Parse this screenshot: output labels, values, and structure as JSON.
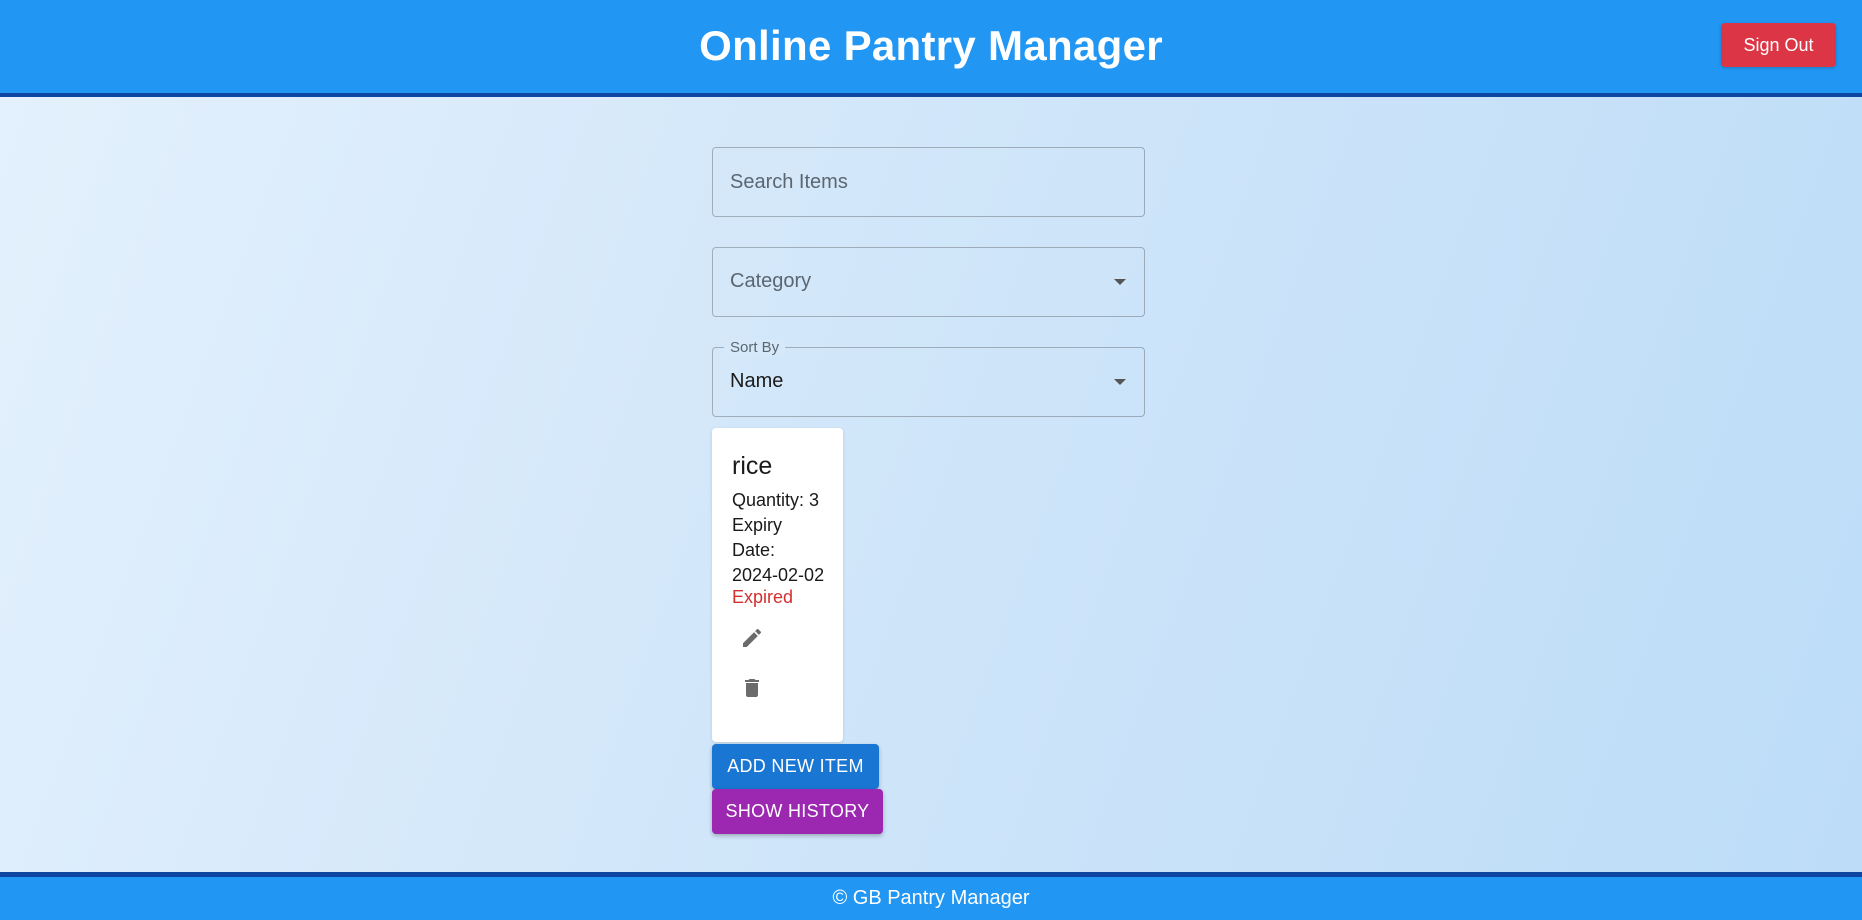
{
  "header": {
    "title": "Online Pantry Manager",
    "sign_out_label": "Sign Out"
  },
  "filters": {
    "search_placeholder": "Search Items",
    "category_label": "Category",
    "sort_label": "Sort By",
    "sort_value": "Name"
  },
  "items": [
    {
      "name": "rice",
      "quantity_text": "Quantity: 3",
      "expiry_line1": "Expiry",
      "expiry_line2": "Date:",
      "expiry_date": "2024-02-02",
      "status": "Expired"
    }
  ],
  "actions": {
    "add_label": "ADD NEW ITEM",
    "history_label": "SHOW HISTORY"
  },
  "footer": {
    "text": "© GB Pantry Manager"
  },
  "colors": {
    "header_bg": "#2196f3",
    "header_border": "#0d47a1",
    "sign_out_bg": "#dc3545",
    "add_button_bg": "#1976d2",
    "history_button_bg": "#9c27b0",
    "expired_text": "#d32f2f"
  },
  "icons": {
    "edit": "pencil-icon",
    "delete": "trash-icon"
  }
}
